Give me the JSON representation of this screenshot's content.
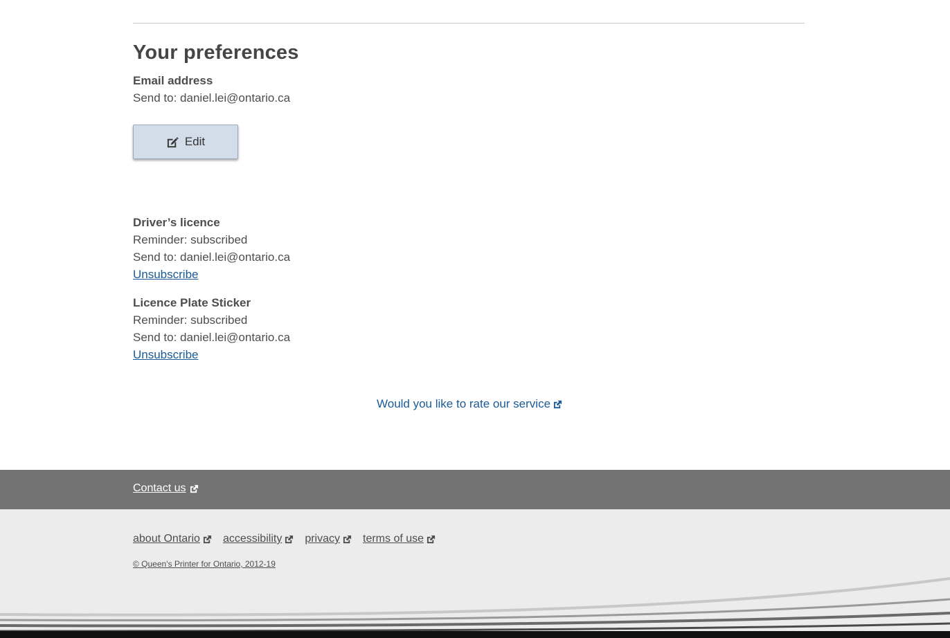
{
  "title": "Your preferences",
  "email_section": {
    "label": "Email address",
    "send_to": "Send to: daniel.lei@ontario.ca",
    "edit_label": "Edit"
  },
  "subscriptions": [
    {
      "name": "Driver’s licence",
      "reminder": "Reminder: subscribed",
      "send_to": "Send to: daniel.lei@ontario.ca",
      "unsubscribe": "Unsubscribe"
    },
    {
      "name": "Licence Plate Sticker",
      "reminder": "Reminder: subscribed",
      "send_to": "Send to: daniel.lei@ontario.ca",
      "unsubscribe": "Unsubscribe"
    }
  ],
  "rate_link": "Would you like to rate our service",
  "contact": {
    "label": "Contact us"
  },
  "footer": {
    "links": [
      "about Ontario",
      "accessibility",
      "privacy",
      "terms of use"
    ],
    "copyright": "© Queen's Printer for Ontario, 2012-19"
  },
  "colors": {
    "link": "#1a5a96",
    "button_bg": "#d2dde9",
    "contact_band": "#737373",
    "footer_bg": "#ececec"
  },
  "icons": {
    "edit": "edit-icon",
    "external": "external-link-icon"
  }
}
